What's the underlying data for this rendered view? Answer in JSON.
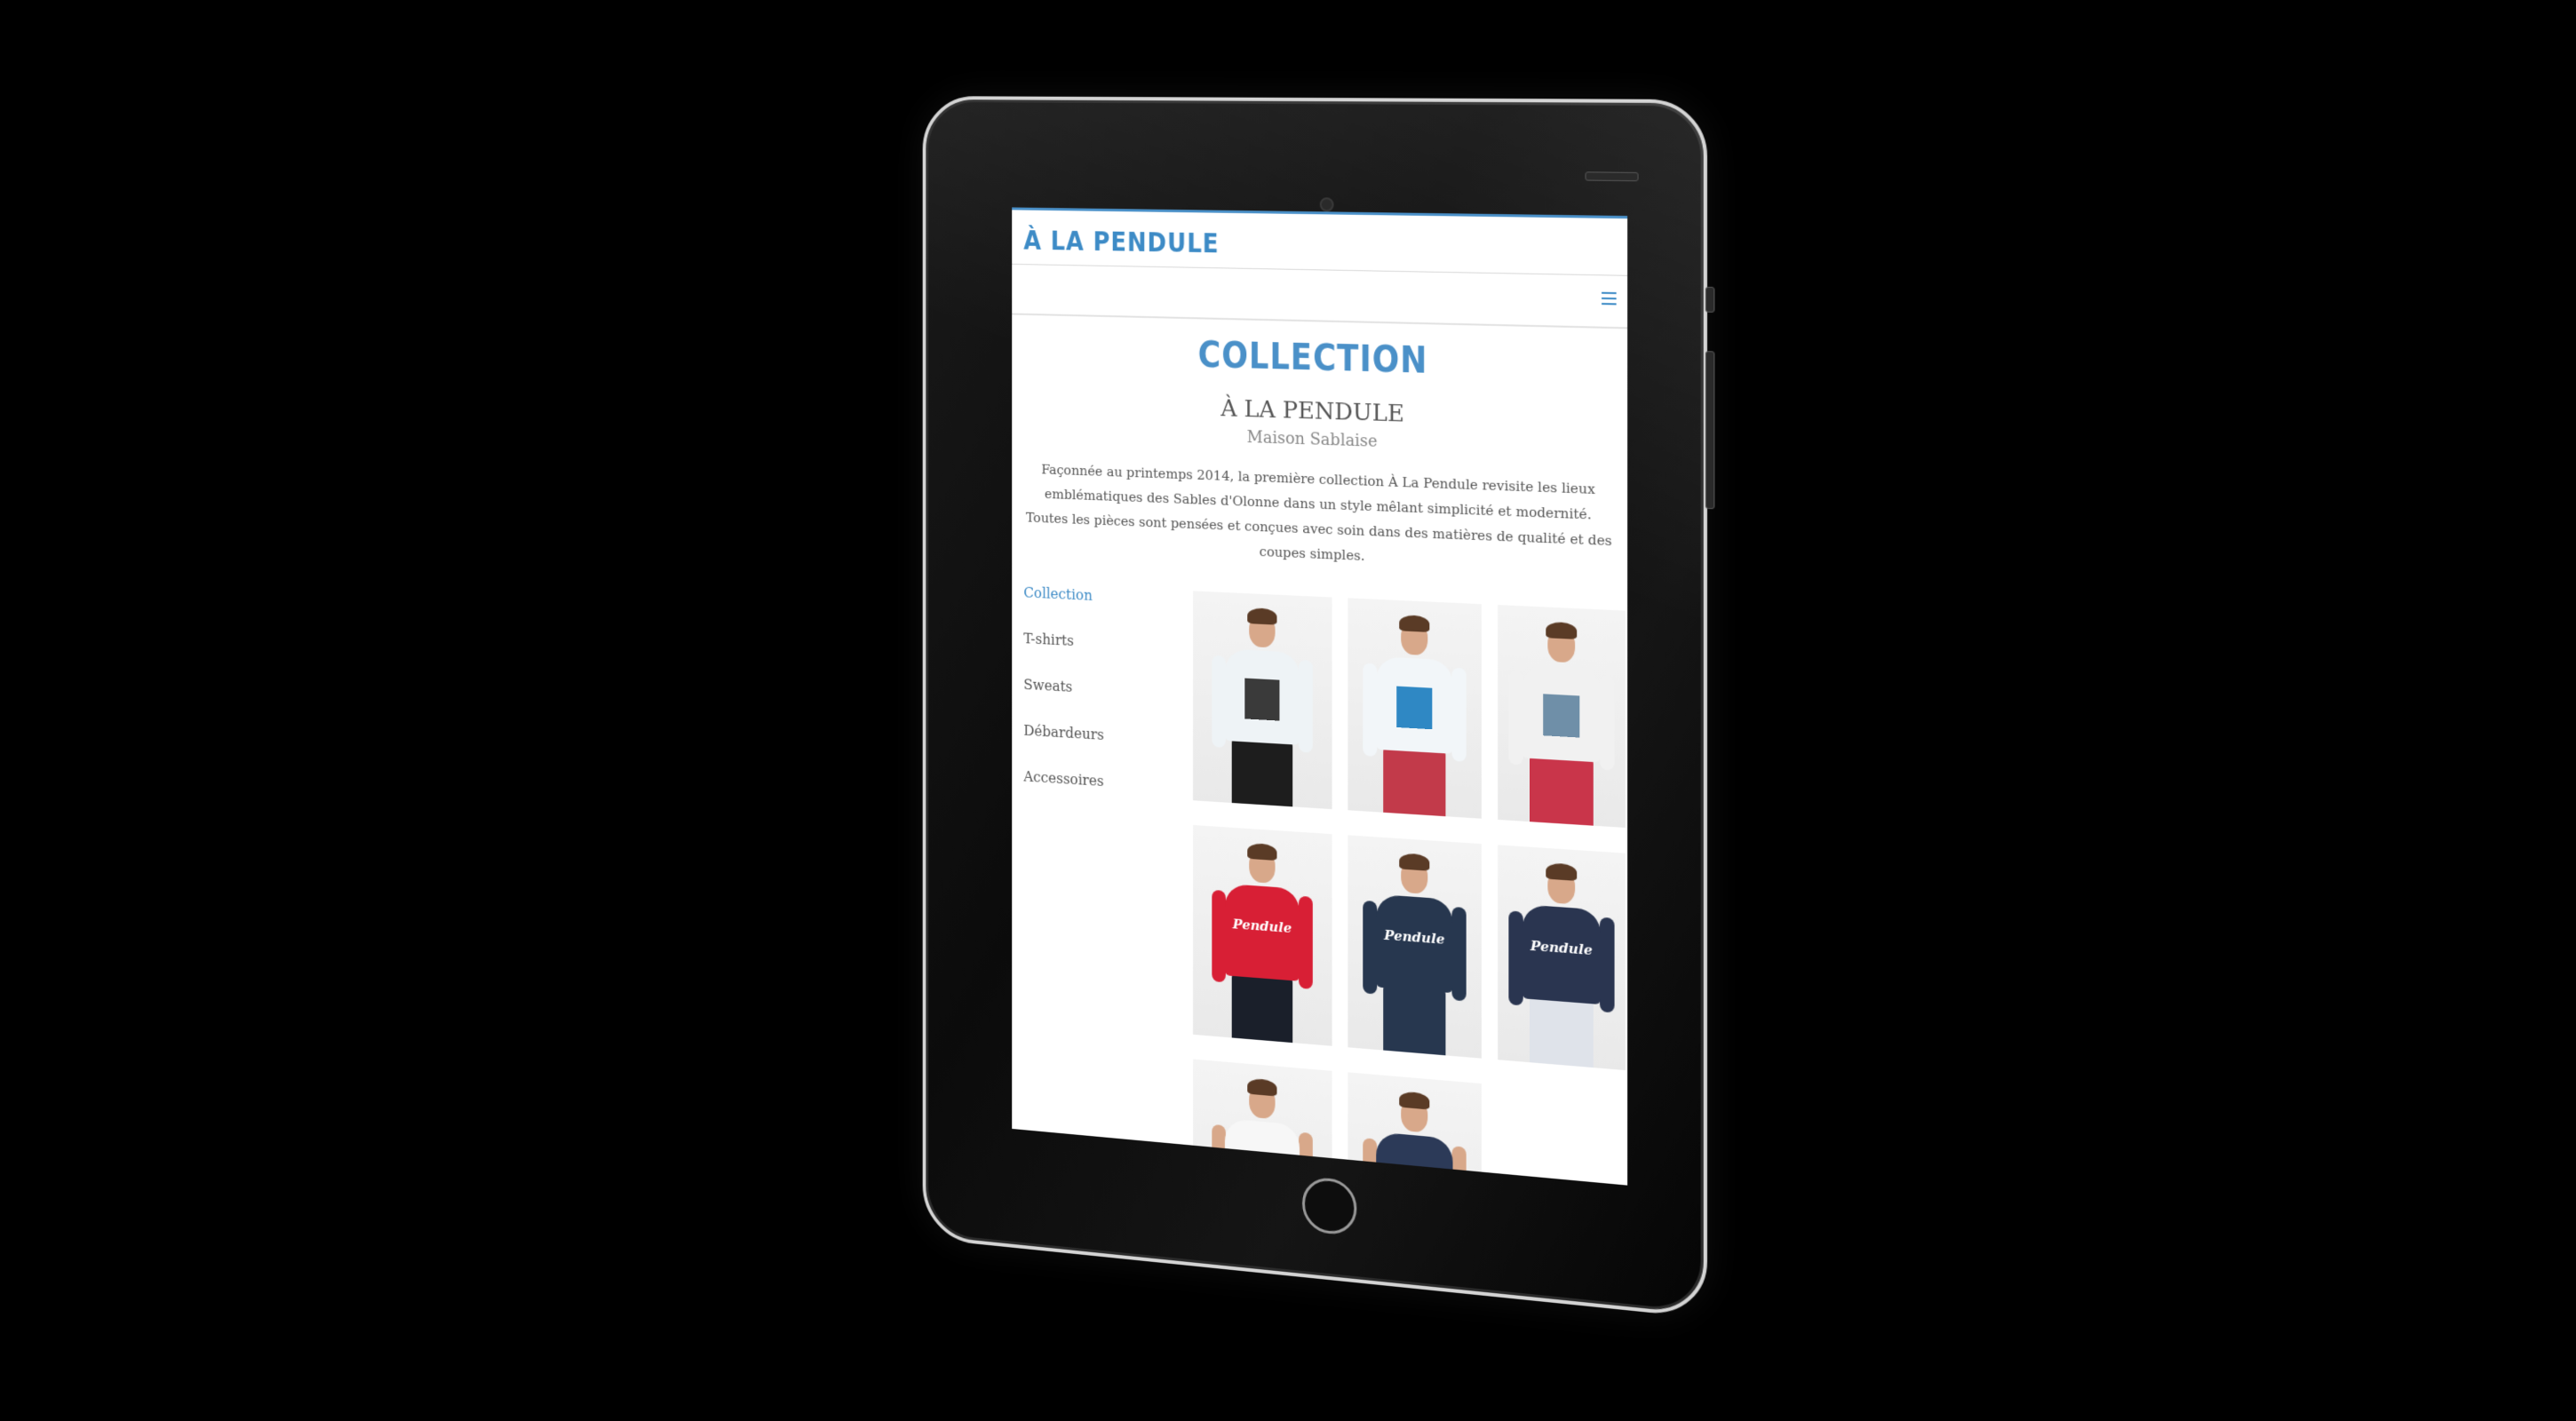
{
  "site": {
    "logo": "À LA PENDULE",
    "menu_icon": "hamburger-icon",
    "accent_color": "#3d8bc6"
  },
  "intro": {
    "title": "Collection",
    "brand": "À LA PENDULE",
    "subtitle": "Maison Sablaise",
    "paragraph_1": "Façonnée au printemps 2014, la première collection À La Pendule revisite les lieux emblématiques des Sables d'Olonne dans un style mêlant simplicité et modernité.",
    "paragraph_2": "Toutes les pièces sont pensées et conçues avec soin dans des matières de qualité et des coupes simples."
  },
  "nav": {
    "items": [
      {
        "label": "Collection",
        "active": true
      },
      {
        "label": "T-shirts",
        "active": false
      },
      {
        "label": "Sweats",
        "active": false
      },
      {
        "label": "Débardeurs",
        "active": false
      },
      {
        "label": "Accessoires",
        "active": false
      }
    ]
  },
  "products": [
    {
      "garment": "white t-shirt with black graphic print",
      "garment_color": "#eef3f6",
      "pants_color": "#1d1d1d",
      "print": "#3a3a3a"
    },
    {
      "garment": "white t-shirt with blue boat print",
      "garment_color": "#f2f6f9",
      "pants_color": "#c23a4a",
      "print": "#2f88c4"
    },
    {
      "garment": "white t-shirt with photo print",
      "garment_color": "#f1f1f1",
      "pants_color": "#c9354a",
      "print": "#6f8fa8"
    },
    {
      "garment": "red sweatshirt with script print",
      "garment_color": "#d81f35",
      "pants_color": "#1a1f2a",
      "script": "Pendule"
    },
    {
      "garment": "navy sweatshirt with script print",
      "garment_color": "#27374f",
      "pants_color": "#27374f",
      "script": "Pendule"
    },
    {
      "garment": "navy sweatshirt with script print",
      "garment_color": "#2a3550",
      "pants_color": "#dfe3ea",
      "script": "Pendule"
    },
    {
      "garment": "white tank top",
      "garment_color": "#f7f7f7",
      "pants_color": "#f0f0f0"
    },
    {
      "garment": "navy tank top",
      "garment_color": "#2c3a58",
      "pants_color": "#f0f0f0"
    }
  ]
}
